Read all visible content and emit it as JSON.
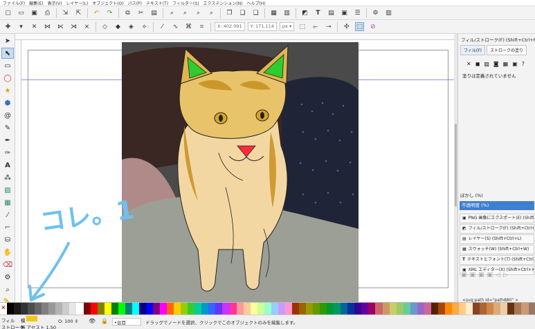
{
  "menu": [
    "ファイル(F)",
    "編集(E)",
    "表示(V)",
    "レイヤー(L)",
    "オブジェクト(O)",
    "パス(P)",
    "テキスト(T)",
    "フィルター(S)",
    "エクステンション(N)",
    "ヘルプ(H)"
  ],
  "ctrl": {
    "x_label": "X:",
    "x_value": "402.091",
    "y_label": "Y:",
    "y_value": "171.114",
    "unit": "px"
  },
  "panel": {
    "title": "フィル/ストローク(F) (Shift+Ctrl+F)",
    "tab_fill": "フィル(F)",
    "tab_stroke": "ストロークの塗り",
    "no_paint_text": "塗りは定義されていません",
    "blur_label": "ぼかし (%)",
    "opacity_label": "不透明度 (%)",
    "docks": [
      "PNG 画像にエクスポート(E) (Shift+Ctrl+E)",
      "フィル/ストローク(F) (Shift+Ctrl+F)",
      "レイヤー(S) (Shift+Ctrl+L)",
      "スウォッチ(W) (Shift+Ctrl+W)",
      "テキストとフォント(T) (Shift+Ctrl+T)",
      "XML エディター(X) (Shift+Ctrl+X)"
    ],
    "xml_node": "<svg:path id=\"path880\" >"
  },
  "annotation": {
    "text": "コレ。1",
    "color": "#6ec1f0"
  },
  "status": {
    "fill_label": "フィル",
    "fill_value": "模",
    "stroke_label": "ストローク",
    "stroke_value": "無 アセスト 1.50",
    "opacity_label": "O:",
    "opacity_value": "100",
    "layer": "•台目",
    "message": "ドラッグでノードを選択、クリックでこのオブジェクトのみを編集します。"
  },
  "colors": {
    "fill_swatch": "#f5c518",
    "accent": "#3f7fd0"
  },
  "palette": [
    "#000000",
    "#1a1a1a",
    "#333333",
    "#4d4d4d",
    "#666666",
    "#808080",
    "#999999",
    "#b3b3b3",
    "#cccccc",
    "#e6e6e6",
    "#ffffff",
    "#800000",
    "#ff0000",
    "#808000",
    "#ffff00",
    "#008000",
    "#00ff00",
    "#008080",
    "#00ffff",
    "#000080",
    "#0000ff",
    "#800080",
    "#ff00ff",
    "#ff6600",
    "#ffcc00",
    "#99cc00",
    "#33cc33",
    "#00cc99",
    "#0099cc",
    "#3366ff",
    "#6633ff",
    "#cc33ff",
    "#ff3399",
    "#ff9999",
    "#ffcc99",
    "#ffff99",
    "#ccff99",
    "#99ffcc",
    "#99ccff",
    "#cc99ff",
    "#ff99cc",
    "#993300",
    "#996600",
    "#999900",
    "#669900",
    "#339900",
    "#009933",
    "#009966",
    "#006699",
    "#003399",
    "#330099",
    "#660099",
    "#990066",
    "#cc6666",
    "#cc9966",
    "#cccc66",
    "#99cc66",
    "#66cc99",
    "#6699cc",
    "#9966cc",
    "#cc6699",
    "#552200",
    "#aa4400",
    "#ff8800",
    "#ffaa44",
    "#ffcc88",
    "#ffeecc",
    "#884422",
    "#aa6633",
    "#cc8844",
    "#ddaa77",
    "#eeccaa",
    "#663311",
    "#aa7755",
    "#cc9977",
    "#997766"
  ]
}
